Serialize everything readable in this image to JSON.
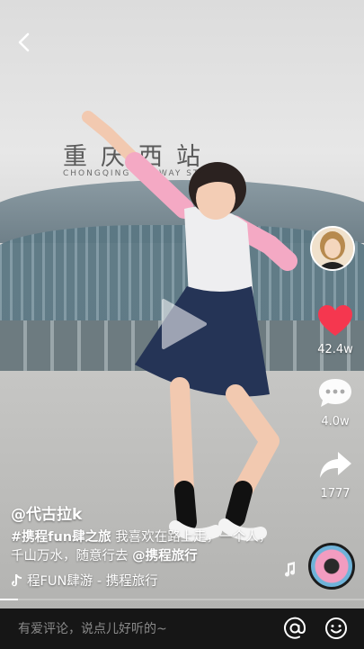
{
  "video": {
    "sign_cn": "重庆西站",
    "sign_en": "CHONGQING RAILWAY STATION"
  },
  "actions": {
    "likes": "42.4w",
    "comments": "4.0w",
    "shares": "1777"
  },
  "post": {
    "author": "@代古拉k",
    "hashtag": "#携程fun肆之旅",
    "caption_text": " 我喜欢在路上走，一个人，千山万水，随意行去 ",
    "mention": "@携程旅行",
    "music": "程FUN肆游 - 携程旅行"
  },
  "progress": 0.05,
  "comment_bar": {
    "placeholder": "有爱评论，说点儿好听的~"
  },
  "colors": {
    "like": "#f5374f",
    "comment_bar_bg": "#161616"
  }
}
